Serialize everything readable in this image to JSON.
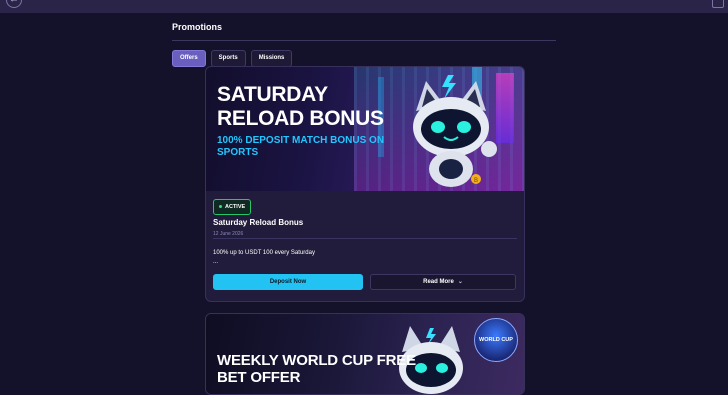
{
  "header": {
    "title": "Promotions"
  },
  "tabs": [
    {
      "label": "Offers",
      "active": true
    },
    {
      "label": "Sports",
      "active": false
    },
    {
      "label": "Missions",
      "active": false
    }
  ],
  "promos": [
    {
      "banner_title": "SATURDAY RELOAD BONUS",
      "banner_subtitle": "100% DEPOSIT MATCH BONUS ON SPORTS",
      "status": "ACTIVE",
      "title": "Saturday Reload Bonus",
      "date": "12 June 2026",
      "description": "100% up to USDT 100 every Saturday",
      "ellipsis": "...",
      "primary_button": "Deposit Now",
      "secondary_button": "Read More"
    },
    {
      "banner_title": "WEEKLY WORLD CUP FREE BET OFFER",
      "badge_text": "WORLD CUP"
    }
  ],
  "colors": {
    "accent": "#22c3f2",
    "tab_active": "#6a5fbf",
    "status_active": "#27c56a",
    "background": "#14112a",
    "card": "#211c3b"
  },
  "icons": [
    "back-arrow-icon",
    "chevron-down-icon",
    "robot-mascot-icon",
    "world-cup-badge-icon"
  ]
}
